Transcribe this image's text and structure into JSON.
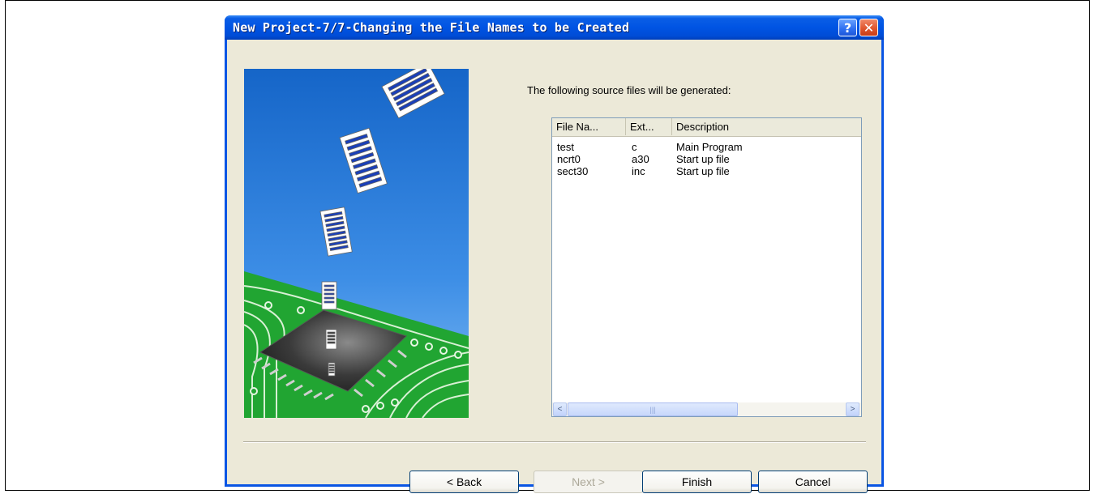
{
  "window": {
    "title": "New Project-7/7-Changing the File Names to be Created",
    "help_glyph": "?",
    "close_glyph": "✕"
  },
  "content": {
    "intro": "The following source files will be generated:"
  },
  "file_list": {
    "columns": [
      "File Na...",
      "Ext...",
      "Description"
    ],
    "rows": [
      {
        "name": "test",
        "ext": "c",
        "desc": "Main Program"
      },
      {
        "name": "ncrt0",
        "ext": "a30",
        "desc": "Start up file"
      },
      {
        "name": "sect30",
        "ext": "inc",
        "desc": "Start up file"
      }
    ],
    "scroll_left_glyph": "<",
    "scroll_right_glyph": ">",
    "scroll_thumb_glyph": "|||"
  },
  "buttons": {
    "back": "< Back",
    "next": "Next >",
    "finish": "Finish",
    "cancel": "Cancel"
  },
  "colors": {
    "titlebar": "#0054e3",
    "dialog_bg": "#ece9d8",
    "art_sky_top": "#1d78d8",
    "art_board": "#20a530"
  }
}
